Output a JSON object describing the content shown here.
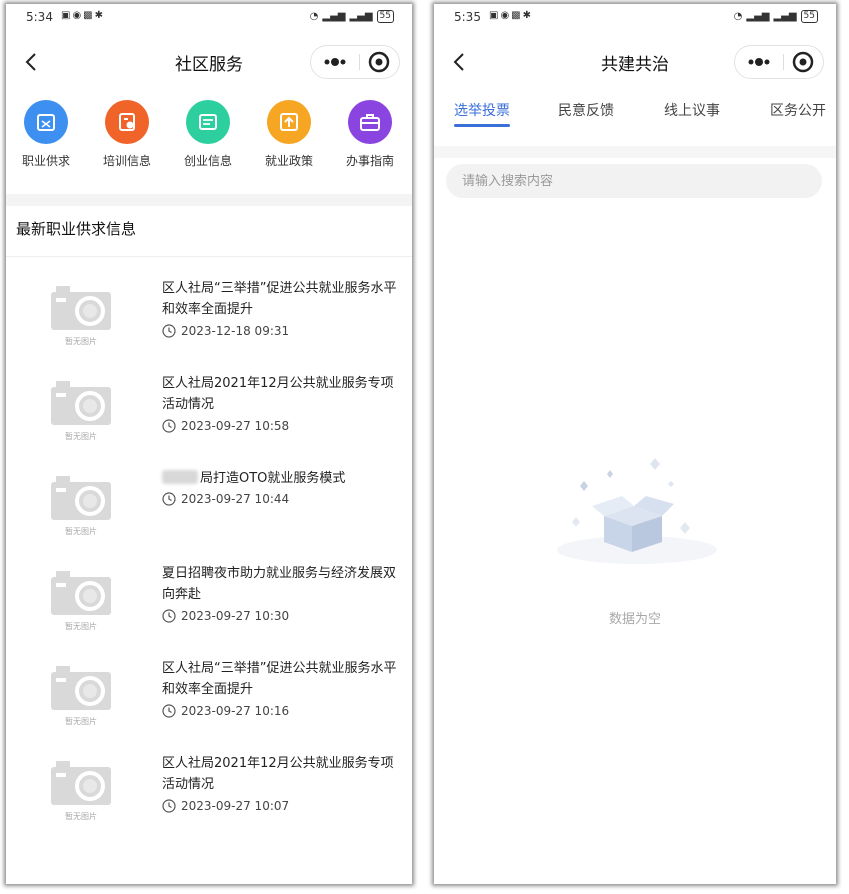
{
  "left_screen": {
    "status": {
      "time": "5:34",
      "battery": "55"
    },
    "nav": {
      "title": "社区服务"
    },
    "services": [
      {
        "label": "职业供求",
        "icon": "briefcase-icon",
        "color": "#3d8ff0"
      },
      {
        "label": "培训信息",
        "icon": "certificate-icon",
        "color": "#f0642a"
      },
      {
        "label": "创业信息",
        "icon": "document-icon",
        "color": "#2ecf9e"
      },
      {
        "label": "就业政策",
        "icon": "upload-icon",
        "color": "#f6a623"
      },
      {
        "label": "办事指南",
        "icon": "toolbox-icon",
        "color": "#8a44e0"
      }
    ],
    "section_title": "最新职业供求信息",
    "thumb_caption": "暂无图片",
    "news": [
      {
        "title": "区人社局“三举措”促进公共就业服务水平和效率全面提升",
        "time": "2023-12-18 09:31"
      },
      {
        "title": "区人社局2021年12月公共就业服务专项活动情况",
        "time": "2023-09-27 10:58"
      },
      {
        "title": "局打造OTO就业服务模式",
        "time": "2023-09-27 10:44"
      },
      {
        "title": "夏日招聘夜市助力就业服务与经济发展双向奔赴",
        "time": "2023-09-27 10:30"
      },
      {
        "title": "区人社局“三举措”促进公共就业服务水平和效率全面提升",
        "time": "2023-09-27 10:16"
      },
      {
        "title": "区人社局2021年12月公共就业服务专项活动情况",
        "time": "2023-09-27 10:07"
      }
    ]
  },
  "right_screen": {
    "status": {
      "time": "5:35",
      "battery": "55"
    },
    "nav": {
      "title": "共建共治"
    },
    "tabs": [
      "选举投票",
      "民意反馈",
      "线上议事",
      "区务公开"
    ],
    "search": {
      "placeholder": "请输入搜索内容",
      "value": ""
    },
    "empty_text": "数据为空"
  },
  "colors": {
    "accent": "#3a6fd8"
  }
}
